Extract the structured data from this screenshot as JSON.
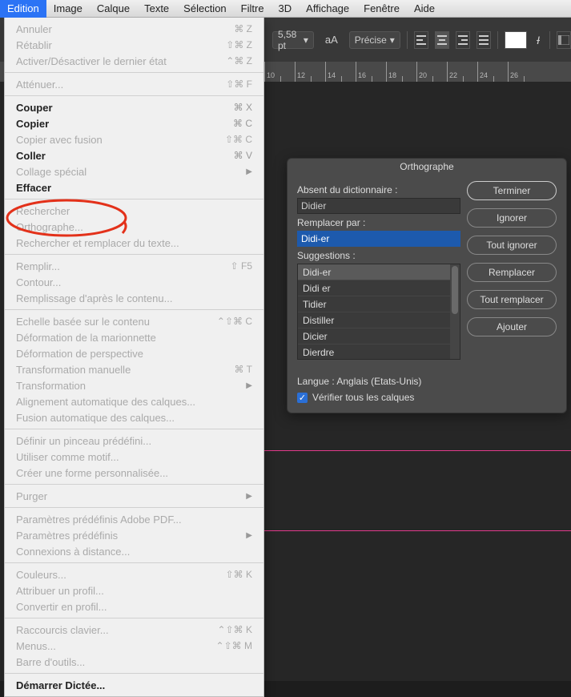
{
  "menubar": {
    "items": [
      "Edition",
      "Image",
      "Calque",
      "Texte",
      "Sélection",
      "Filtre",
      "3D",
      "Affichage",
      "Fenêtre",
      "Aide"
    ],
    "active_index": 0
  },
  "toolbar": {
    "size_value": "5,58 pt",
    "aa_label": "aA",
    "precise_label": "Précise"
  },
  "ruler": {
    "ticks": [
      "10",
      "12",
      "14",
      "16",
      "18",
      "20",
      "22",
      "24",
      "26"
    ]
  },
  "dropdown": {
    "items": [
      {
        "label": "Annuler",
        "shortcut": "⌘ Z",
        "disabled": true
      },
      {
        "label": "Rétablir",
        "shortcut": "⇧⌘ Z",
        "disabled": true
      },
      {
        "label": "Activer/Désactiver le dernier état",
        "shortcut": "⌃⌘ Z",
        "disabled": true
      },
      {
        "divider": true
      },
      {
        "label": "Atténuer...",
        "shortcut": "⇧⌘ F",
        "disabled": true
      },
      {
        "divider": true
      },
      {
        "label": "Couper",
        "shortcut": "⌘ X",
        "bold": true
      },
      {
        "label": "Copier",
        "shortcut": "⌘ C",
        "bold": true
      },
      {
        "label": "Copier avec fusion",
        "shortcut": "⇧⌘ C",
        "disabled": true
      },
      {
        "label": "Coller",
        "shortcut": "⌘ V",
        "bold": true
      },
      {
        "label": "Collage spécial",
        "submenu": true,
        "disabled": true
      },
      {
        "label": "Effacer",
        "bold": true
      },
      {
        "divider": true
      },
      {
        "label": "Rechercher",
        "disabled": true
      },
      {
        "label": "Orthographe...",
        "disabled": true
      },
      {
        "label": "Rechercher et remplacer du texte...",
        "disabled": true
      },
      {
        "divider": true
      },
      {
        "label": "Remplir...",
        "shortcut": "⇧ F5",
        "disabled": true
      },
      {
        "label": "Contour...",
        "disabled": true
      },
      {
        "label": "Remplissage d'après le contenu...",
        "disabled": true
      },
      {
        "divider": true
      },
      {
        "label": "Echelle basée sur le contenu",
        "shortcut": "⌃⇧⌘ C",
        "disabled": true
      },
      {
        "label": "Déformation de la marionnette",
        "disabled": true
      },
      {
        "label": "Déformation de perspective",
        "disabled": true
      },
      {
        "label": "Transformation manuelle",
        "shortcut": "⌘ T",
        "disabled": true
      },
      {
        "label": "Transformation",
        "submenu": true,
        "disabled": true
      },
      {
        "label": "Alignement automatique des calques...",
        "disabled": true
      },
      {
        "label": "Fusion automatique des calques...",
        "disabled": true
      },
      {
        "divider": true
      },
      {
        "label": "Définir un pinceau prédéfini...",
        "disabled": true
      },
      {
        "label": "Utiliser comme motif...",
        "disabled": true
      },
      {
        "label": "Créer une forme personnalisée...",
        "disabled": true
      },
      {
        "divider": true
      },
      {
        "label": "Purger",
        "submenu": true,
        "disabled": true
      },
      {
        "divider": true
      },
      {
        "label": "Paramètres prédéfinis Adobe PDF...",
        "disabled": true
      },
      {
        "label": "Paramètres prédéfinis",
        "submenu": true,
        "disabled": true
      },
      {
        "label": "Connexions à distance...",
        "disabled": true
      },
      {
        "divider": true
      },
      {
        "label": "Couleurs...",
        "shortcut": "⇧⌘ K",
        "disabled": true
      },
      {
        "label": "Attribuer un profil...",
        "disabled": true
      },
      {
        "label": "Convertir en profil...",
        "disabled": true
      },
      {
        "divider": true
      },
      {
        "label": "Raccourcis clavier...",
        "shortcut": "⌃⇧⌘ K",
        "disabled": true
      },
      {
        "label": "Menus...",
        "shortcut": "⌃⇧⌘ M",
        "disabled": true
      },
      {
        "label": "Barre d'outils...",
        "disabled": true
      },
      {
        "divider": true
      },
      {
        "label": "Démarrer Dictée...",
        "bold": true
      }
    ]
  },
  "dialog": {
    "title": "Orthographe",
    "absent_label": "Absent du dictionnaire :",
    "absent_value": "Didier",
    "replace_label": "Remplacer par :",
    "replace_value": "Didi-er",
    "suggestions_label": "Suggestions :",
    "suggestions": [
      "Didi-er",
      "Didi er",
      "Tidier",
      "Distiller",
      "Dicier",
      "Dierdre"
    ],
    "buttons": {
      "terminer": "Terminer",
      "ignorer": "Ignorer",
      "tout_ignorer": "Tout ignorer",
      "remplacer": "Remplacer",
      "tout_remplacer": "Tout remplacer",
      "ajouter": "Ajouter"
    },
    "langue_label": "Langue : Anglais (Etats-Unis)",
    "check_label": "Vérifier tous les calques",
    "checked": true
  }
}
